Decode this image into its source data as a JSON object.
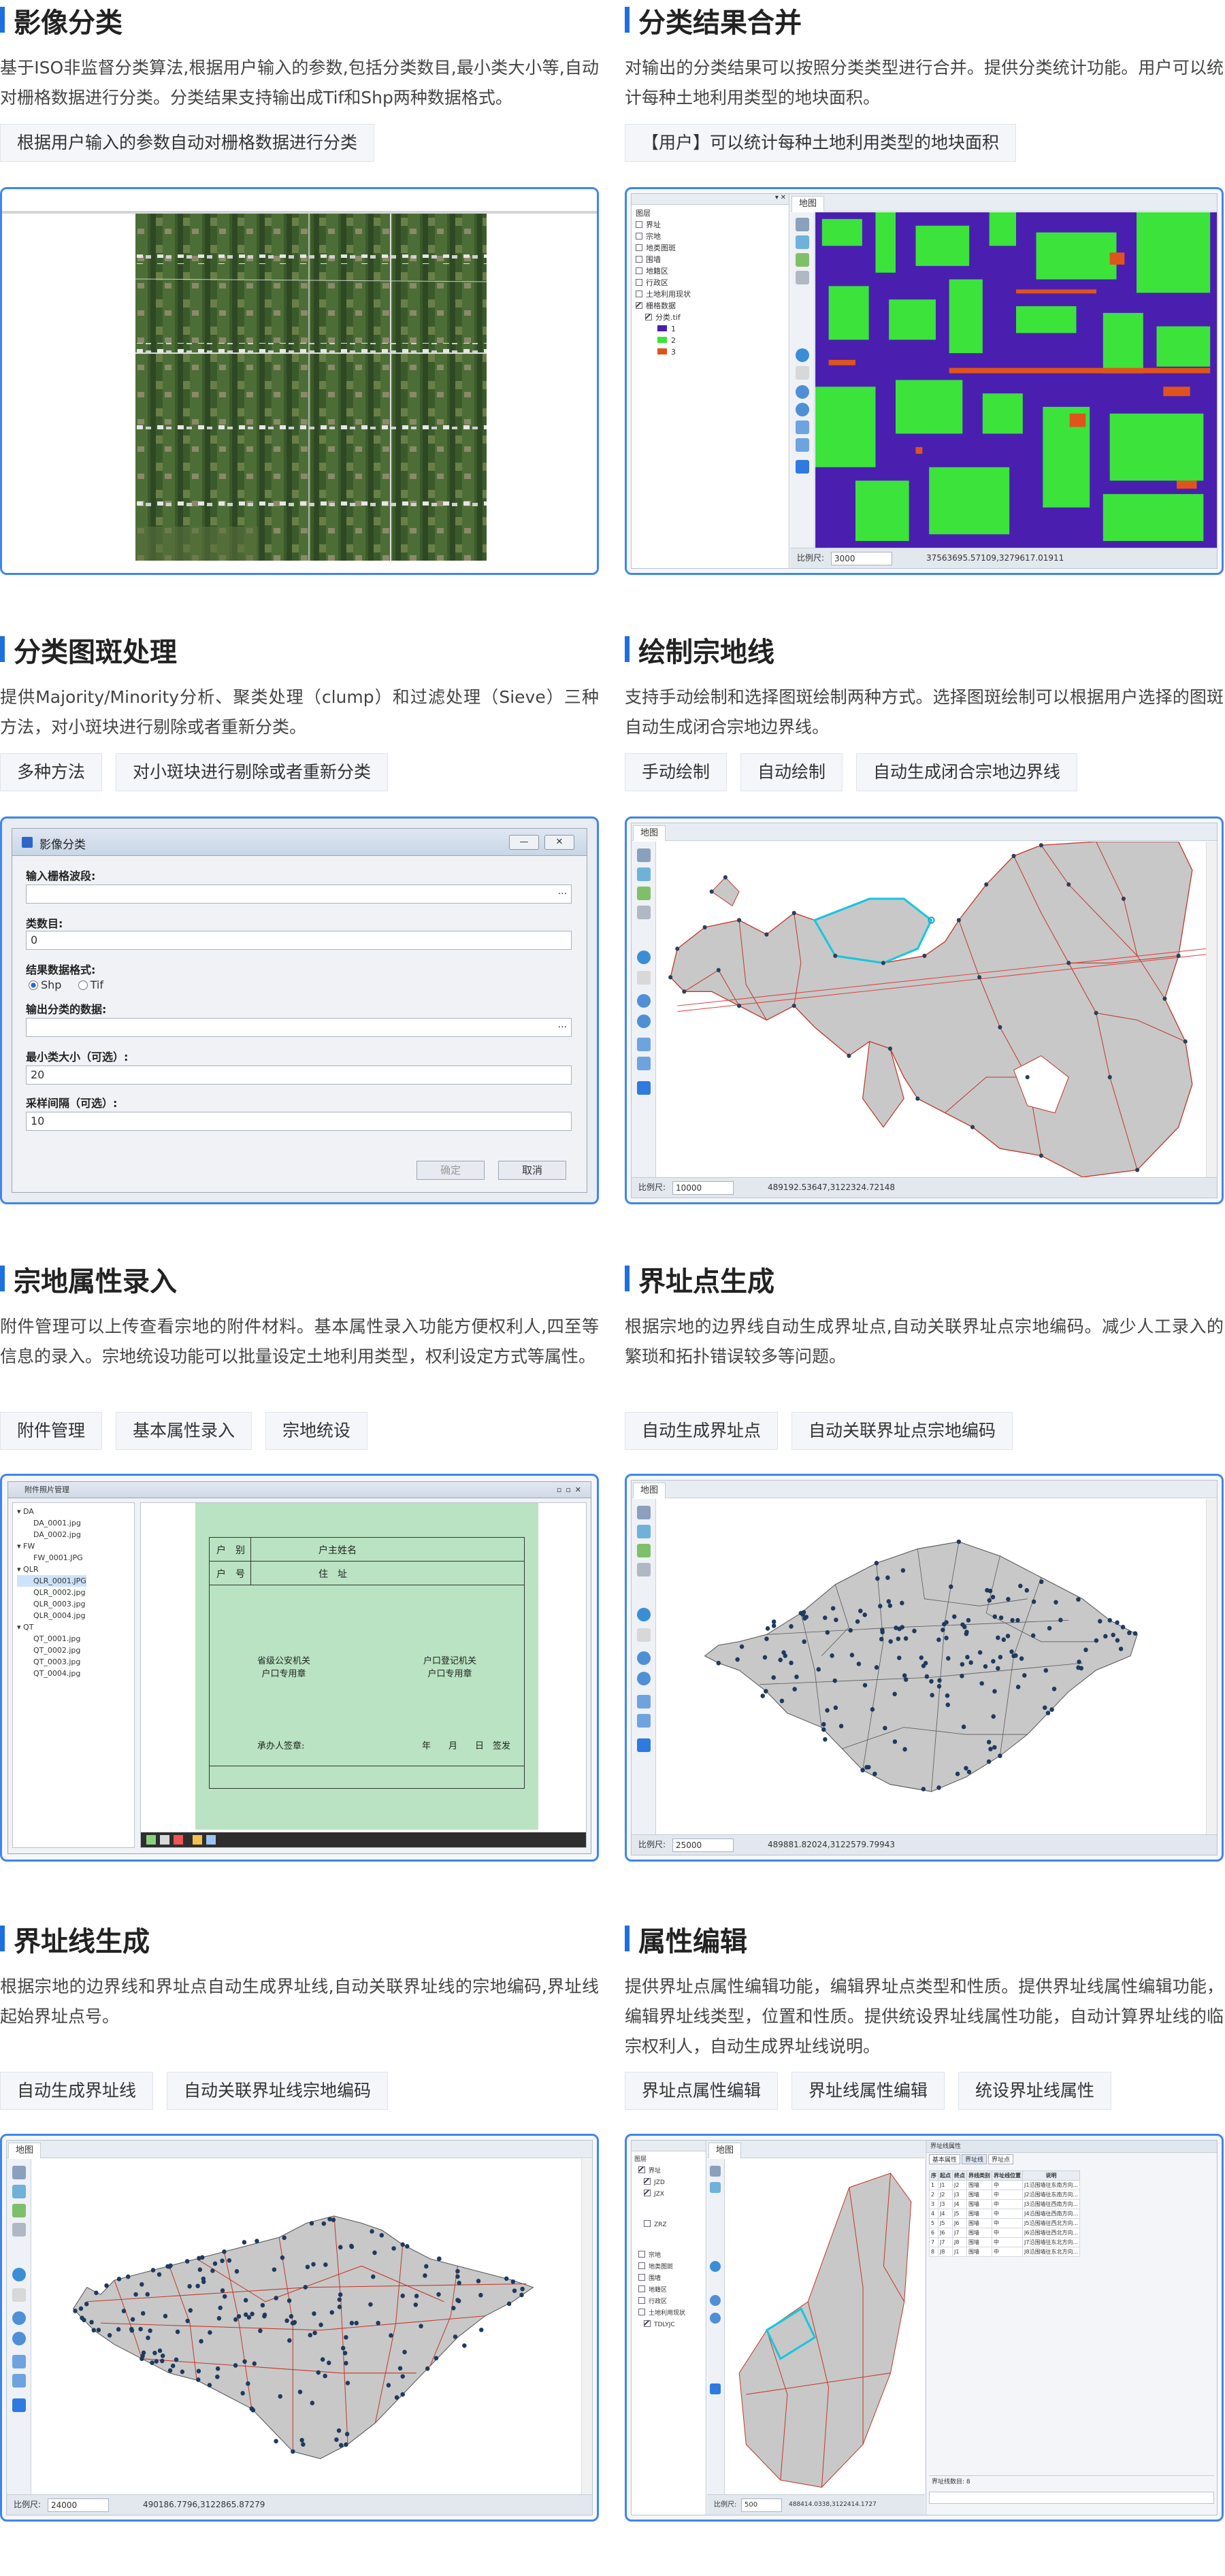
{
  "features": [
    {
      "title": "影像分类",
      "desc": "基于ISO非监督分类算法,根据用户输入的参数,包括分类数目,最小类大小等,自动对栅格数据进行分类。分类结果支持输出成Tif和Shp两种数据格式。",
      "tags": [
        "根据用户输入的参数自动对栅格数据进行分类"
      ]
    },
    {
      "title": "分类结果合并",
      "desc": "对输出的分类结果可以按照分类类型进行合并。提供分类统计功能。用户可以统计每种土地利用类型的地块面积。",
      "tags": [
        "【用户】可以统计每种土地利用类型的地块面积"
      ],
      "screenshot": {
        "tab": "地图",
        "layer_panel_title": "图层",
        "layers": [
          "界址",
          "宗地",
          "地类图斑",
          "围墙",
          "地籍区",
          "行政区",
          "土地利用现状",
          "栅格数据"
        ],
        "raster_name": "分类.tif",
        "classes": [
          {
            "label": "1",
            "color": "#4a1fb0"
          },
          {
            "label": "2",
            "color": "#3be33b"
          },
          {
            "label": "3",
            "color": "#e0541c"
          }
        ],
        "scale_label": "比例尺:",
        "scale_value": "3000",
        "coords": "37563695.57109,3279617.01911"
      }
    },
    {
      "title": "分类图斑处理",
      "desc": "提供Majority/Minority分析、聚类处理（clump）和过滤处理（Sieve）三种方法，对小斑块进行剔除或者重新分类。",
      "tags": [
        "多种方法",
        "对小斑块进行剔除或者重新分类"
      ],
      "dialog": {
        "title": "影像分类",
        "min_btn": "—",
        "close_btn": "✕",
        "input_raster_label": "输入栅格波段:",
        "input_raster_value": "",
        "class_count_label": "类数目:",
        "class_count_value": "0",
        "format_label": "结果数据格式:",
        "format_shp": "Shp",
        "format_tif": "Tif",
        "output_label": "输出分类的数据:",
        "output_value": "",
        "min_class_label": "最小类大小（可选）:",
        "min_class_value": "20",
        "sample_label": "采样间隔（可选）:",
        "sample_value": "10",
        "ok": "确定",
        "cancel": "取消",
        "dots": "···"
      }
    },
    {
      "title": "绘制宗地线",
      "desc": "支持手动绘制和选择图斑绘制两种方式。选择图斑绘制可以根据用户选择的图斑自动生成闭合宗地边界线。",
      "tags": [
        "手动绘制",
        "自动绘制",
        "自动生成闭合宗地边界线"
      ],
      "screenshot": {
        "tab": "地图",
        "scale_label": "比例尺:",
        "scale_value": "10000",
        "coords": "489192.53647,3122324.72148"
      }
    },
    {
      "title": "宗地属性录入",
      "desc": "附件管理可以上传查看宗地的附件材料。基本属性录入功能方便权利人,四至等信息的录入。宗地统设功能可以批量设定土地利用类型，权利设定方式等属性。",
      "tags": [
        "附件管理",
        "基本属性录入",
        "宗地统设"
      ],
      "window": {
        "title": "附件照片管理",
        "folders": [
          {
            "name": "DA",
            "files": [
              "DA_0001.jpg",
              "DA_0002.jpg"
            ]
          },
          {
            "name": "FW",
            "files": [
              "FW_0001.JPG"
            ]
          },
          {
            "name": "QLR",
            "files": [
              "QLR_0001.JPG",
              "QLR_0002.jpg",
              "QLR_0003.jpg",
              "QLR_0004.jpg"
            ]
          },
          {
            "name": "QT",
            "files": [
              "QT_0001.jpg",
              "QT_0002.jpg",
              "QT_0003.jpg",
              "QT_0004.jpg"
            ]
          }
        ],
        "card": {
          "r1c1": "户　别",
          "r1c2": "户主姓名",
          "r2c1": "户　号",
          "r2c2": "住　址",
          "seal_left": "省级公安机关\n户口专用章",
          "seal_right": "户口登记机关\n户口专用章",
          "signer": "承办人签章:",
          "date": "年　　月　　日　签发"
        }
      }
    },
    {
      "title": "界址点生成",
      "desc": "根据宗地的边界线自动生成界址点,自动关联界址点宗地编码。减少人工录入的繁琐和拓扑错误较多等问题。",
      "tags": [
        "自动生成界址点",
        "自动关联界址点宗地编码"
      ],
      "screenshot": {
        "tab": "地图",
        "scale_label": "比例尺:",
        "scale_value": "25000",
        "coords": "489881.82024,3122579.79943"
      }
    },
    {
      "title": "界址线生成",
      "desc": "根据宗地的边界线和界址点自动生成界址线,自动关联界址线的宗地编码,界址线起始界址点号。",
      "tags": [
        "自动生成界址线",
        "自动关联界址线宗地编码"
      ],
      "screenshot": {
        "tab": "地图",
        "scale_label": "比例尺:",
        "scale_value": "24000",
        "coords": "490186.7796,3122865.87279"
      }
    },
    {
      "title": "属性编辑",
      "desc": "提供界址点属性编辑功能，编辑界址点类型和性质。提供界址线属性编辑功能，编辑界址线类型，位置和性质。提供统设界址线属性功能，自动计算界址线的临宗权利人，自动生成界址线说明。",
      "tags": [
        "界址点属性编辑",
        "界址线属性编辑",
        "统设界址线属性"
      ],
      "screenshot": {
        "tab": "地图",
        "tree_title": "图层",
        "tree": [
          "界址",
          "JZD",
          "JZX",
          "ZRZ",
          "宗地",
          "地类图斑",
          "围墙",
          "地籍区",
          "行政区",
          "土地利用现状",
          "TDLYJC"
        ],
        "attr_title": "界址线属性",
        "attr_tabs": [
          "基本属性",
          "界址线",
          "界址点"
        ],
        "attr_headers": [
          "序",
          "起点",
          "终点",
          "界线类别",
          "界址线位置",
          "说明"
        ],
        "attr_rows": [
          [
            "1",
            "J1",
            "J2",
            "围墙",
            "中",
            "J1沿围墙往东南方向..."
          ],
          [
            "2",
            "J2",
            "J3",
            "围墙",
            "中",
            "J2沿围墙往东南方向..."
          ],
          [
            "3",
            "J3",
            "J4",
            "围墙",
            "中",
            "J3沿围墙往西南方向..."
          ],
          [
            "4",
            "J4",
            "J5",
            "围墙",
            "中",
            "J4沿围墙往西南方向..."
          ],
          [
            "5",
            "J5",
            "J6",
            "围墙",
            "中",
            "J5沿围墙往西北方向..."
          ],
          [
            "6",
            "J6",
            "J7",
            "围墙",
            "中",
            "J6沿围墙往西北方向..."
          ],
          [
            "7",
            "J7",
            "J8",
            "围墙",
            "中",
            "J7沿围墙往东北方向..."
          ],
          [
            "8",
            "J8",
            "J1",
            "围墙",
            "中",
            "J8沿围墙往东北方向..."
          ]
        ],
        "attr_footer": "界址线数目: 8",
        "scale_label": "比例尺:",
        "scale_value": "500",
        "coords": "488414.0338,3122414.1727"
      }
    }
  ]
}
